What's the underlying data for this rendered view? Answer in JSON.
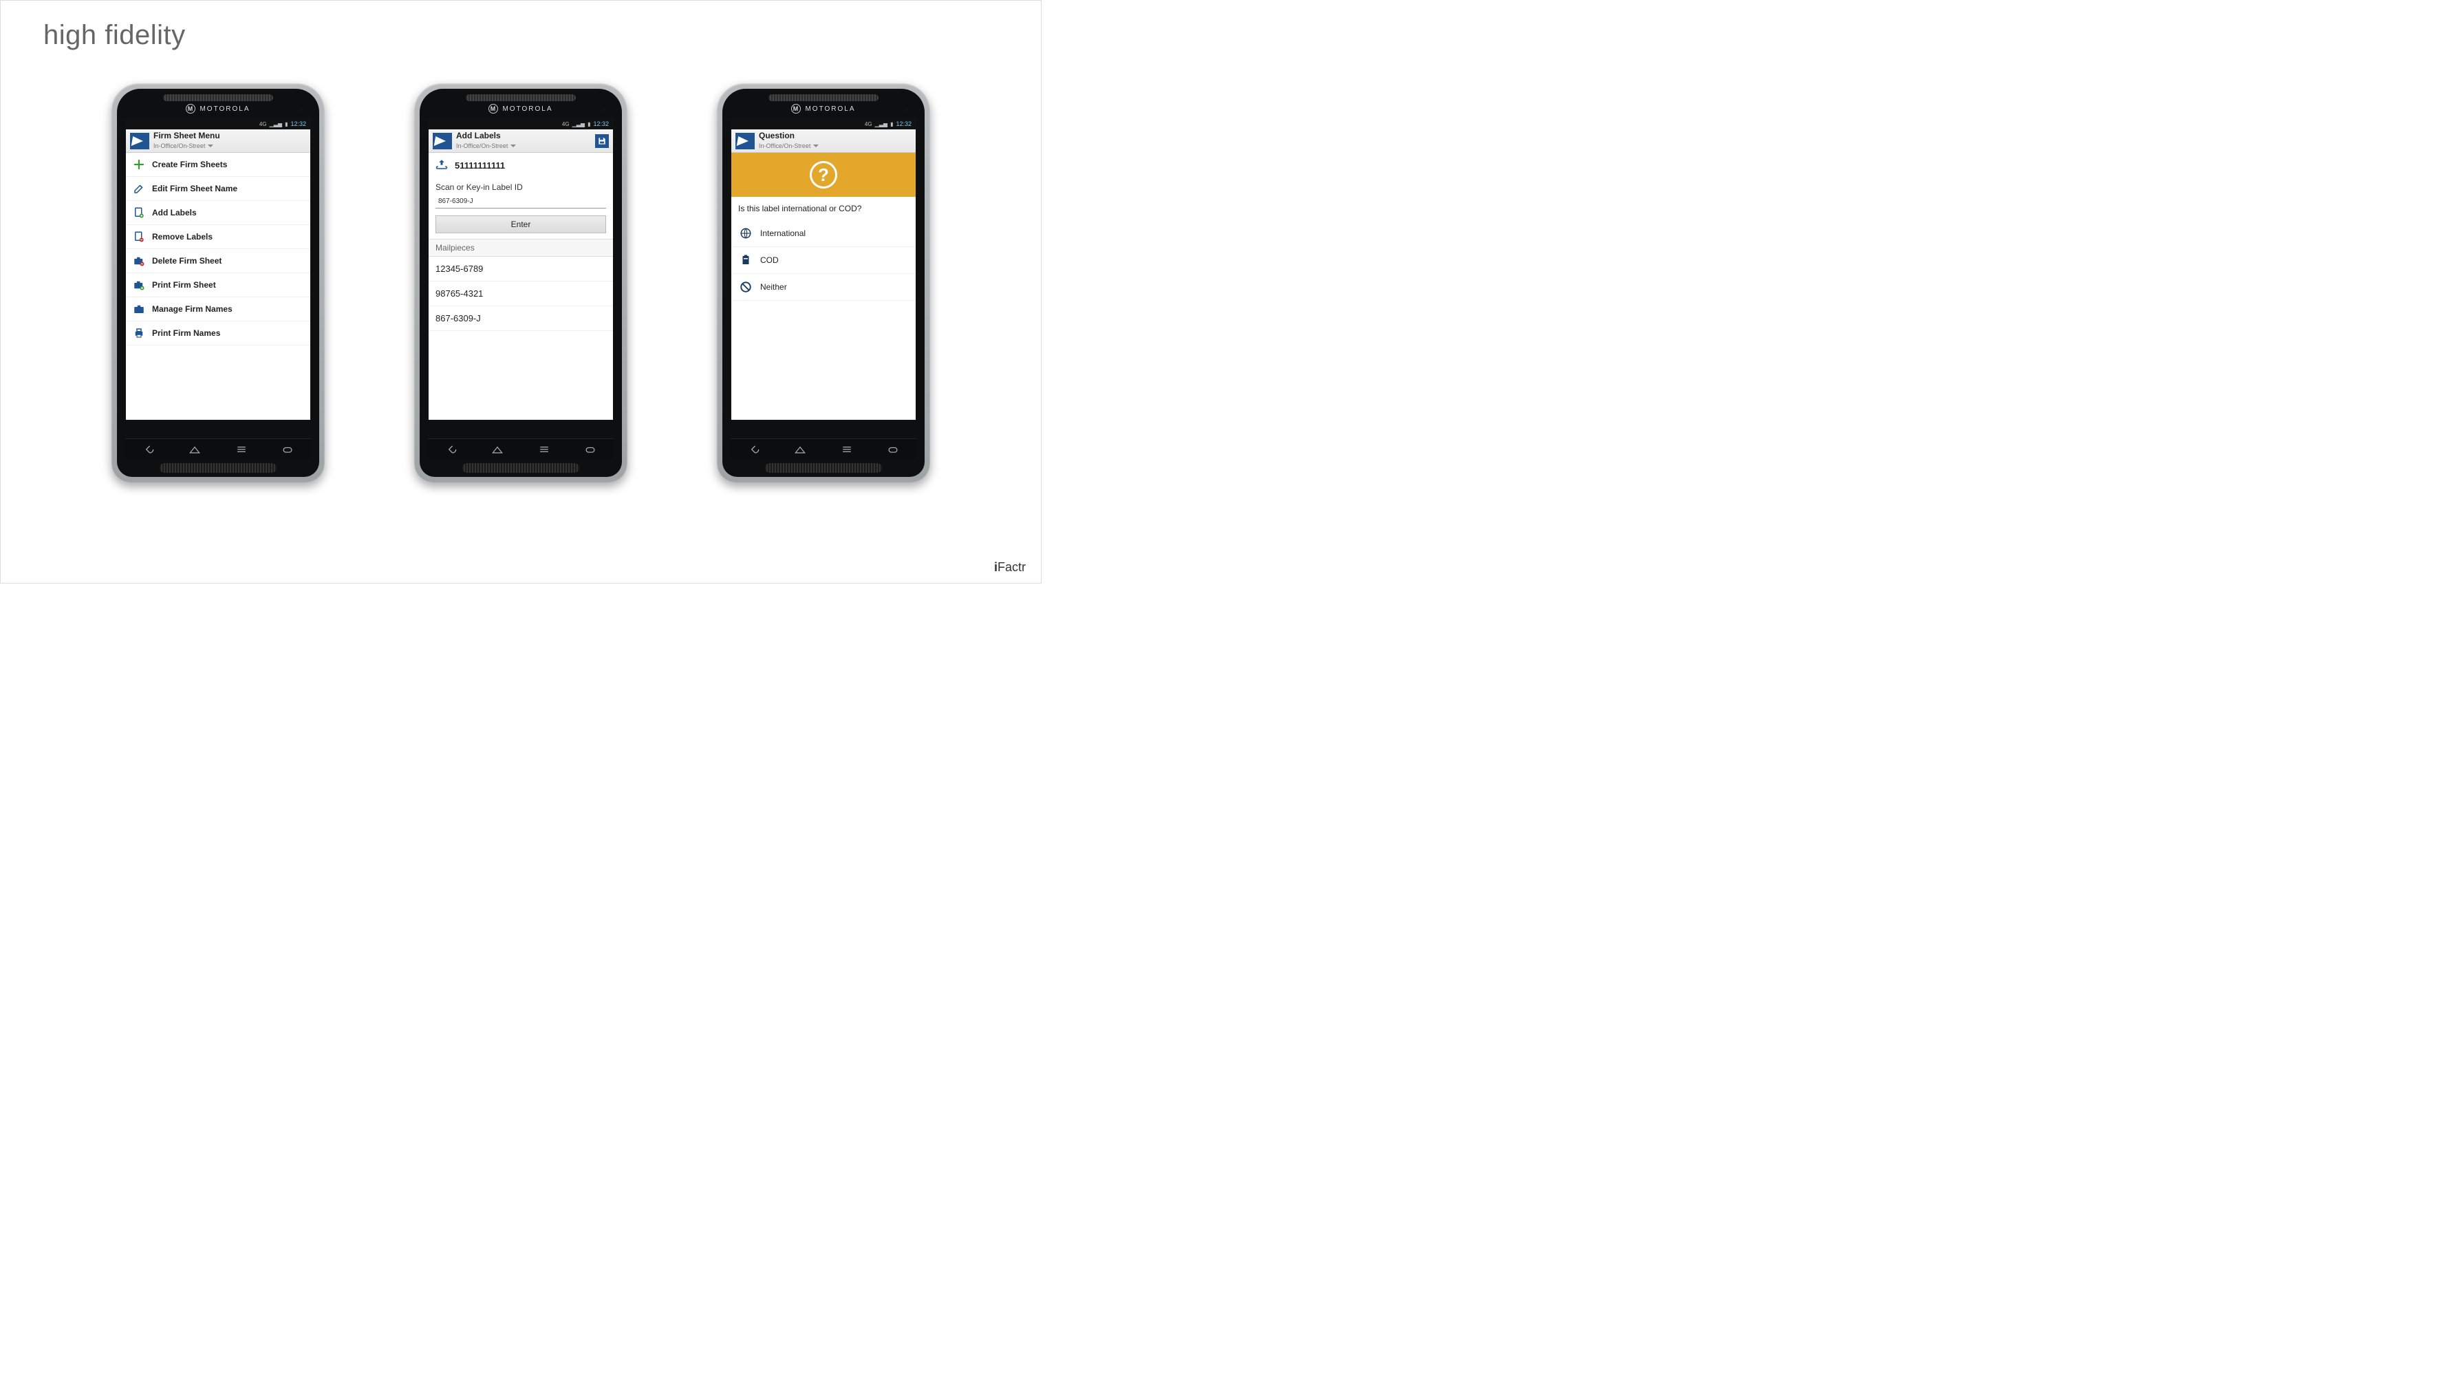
{
  "page_title": "high fidelity",
  "footer_brand": "Factr",
  "footer_brand_prefix": "i",
  "phone_brand": "MOTOROLA",
  "status_time": "12:32",
  "status_net": "4G",
  "header_sub": "In-Office/On-Street",
  "phone1": {
    "title": "Firm Sheet Menu",
    "menu": [
      {
        "label": "Create Firm Sheets",
        "icon": "plus"
      },
      {
        "label": "Edit Firm Sheet Name",
        "icon": "edit"
      },
      {
        "label": "Add Labels",
        "icon": "doc-add"
      },
      {
        "label": "Remove Labels",
        "icon": "doc-remove"
      },
      {
        "label": "Delete Firm Sheet",
        "icon": "briefcase-del"
      },
      {
        "label": "Print Firm Sheet",
        "icon": "briefcase-add"
      },
      {
        "label": "Manage Firm Names",
        "icon": "briefcase"
      },
      {
        "label": "Print Firm Names",
        "icon": "printer"
      }
    ]
  },
  "phone2": {
    "title": "Add Labels",
    "upload_id": "51111111111",
    "scan_label": "Scan or Key-in Label ID",
    "input_value": "867-6309-J",
    "enter_label": "Enter",
    "mailpieces_header": "Mailpieces",
    "mailpieces": [
      "12345-6789",
      "98765-4321",
      "867-6309-J"
    ]
  },
  "phone3": {
    "title": "Question",
    "question_text": "Is this label international or COD?",
    "options": [
      {
        "label": "International",
        "icon": "globe"
      },
      {
        "label": "COD",
        "icon": "clipboard"
      },
      {
        "label": "Neither",
        "icon": "no"
      }
    ]
  }
}
